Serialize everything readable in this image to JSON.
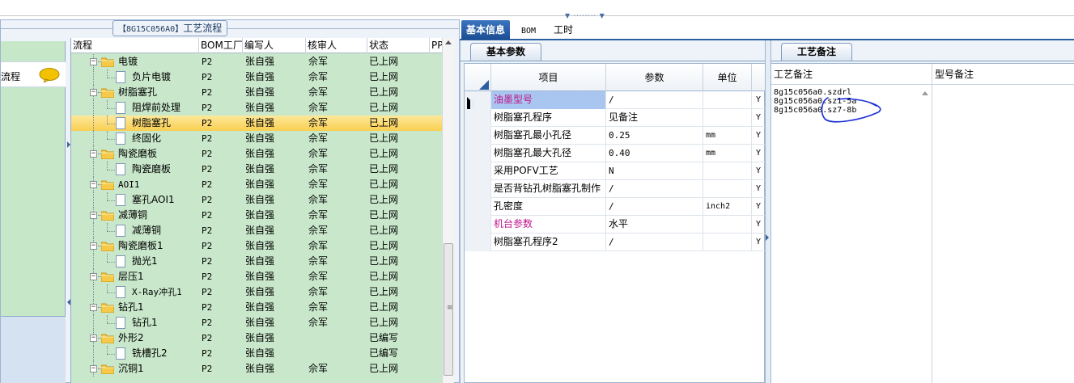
{
  "left_panel": {
    "title_code": "【8G15C056A0】",
    "title_text": "工艺流程",
    "nav_item_label": "流程",
    "tree_columns": [
      "流程",
      "BOM工厂",
      "编写人",
      "核审人",
      "状态",
      "PP"
    ],
    "tree_rows": [
      {
        "name": "电镀",
        "type": "folder",
        "bom": "P2",
        "writer": "张自强",
        "reviewer": "佘军",
        "status": "已上网"
      },
      {
        "name": "负片电镀",
        "type": "doc",
        "bom": "P2",
        "writer": "张自强",
        "reviewer": "佘军",
        "status": "已上网"
      },
      {
        "name": "树脂塞孔",
        "type": "folder",
        "bom": "P2",
        "writer": "张自强",
        "reviewer": "佘军",
        "status": "已上网"
      },
      {
        "name": "阻焊前处理",
        "type": "doc",
        "bom": "P2",
        "writer": "张自强",
        "reviewer": "佘军",
        "status": "已上网"
      },
      {
        "name": "树脂塞孔",
        "type": "doc",
        "bom": "P2",
        "writer": "张自强",
        "reviewer": "佘军",
        "status": "已上网",
        "selected": true
      },
      {
        "name": "终固化",
        "type": "doc",
        "bom": "P2",
        "writer": "张自强",
        "reviewer": "佘军",
        "status": "已上网"
      },
      {
        "name": "陶瓷磨板",
        "type": "folder",
        "bom": "P2",
        "writer": "张自强",
        "reviewer": "佘军",
        "status": "已上网"
      },
      {
        "name": "陶瓷磨板",
        "type": "doc",
        "bom": "P2",
        "writer": "张自强",
        "reviewer": "佘军",
        "status": "已上网"
      },
      {
        "name": "AOI1",
        "type": "folder",
        "bom": "P2",
        "writer": "张自强",
        "reviewer": "佘军",
        "status": "已上网"
      },
      {
        "name": "塞孔AOI1",
        "type": "doc",
        "bom": "P2",
        "writer": "张自强",
        "reviewer": "佘军",
        "status": "已上网"
      },
      {
        "name": "减薄铜",
        "type": "folder",
        "bom": "P2",
        "writer": "张自强",
        "reviewer": "佘军",
        "status": "已上网"
      },
      {
        "name": "减薄铜",
        "type": "doc",
        "bom": "P2",
        "writer": "张自强",
        "reviewer": "佘军",
        "status": "已上网"
      },
      {
        "name": "陶瓷磨板1",
        "type": "folder",
        "bom": "P2",
        "writer": "张自强",
        "reviewer": "佘军",
        "status": "已上网"
      },
      {
        "name": "抛光1",
        "type": "doc",
        "bom": "P2",
        "writer": "张自强",
        "reviewer": "佘军",
        "status": "已上网"
      },
      {
        "name": "层压1",
        "type": "folder",
        "bom": "P2",
        "writer": "张自强",
        "reviewer": "佘军",
        "status": "已上网"
      },
      {
        "name": "X-Ray冲孔1",
        "type": "doc",
        "bom": "P2",
        "writer": "张自强",
        "reviewer": "佘军",
        "status": "已上网"
      },
      {
        "name": "钻孔1",
        "type": "folder",
        "bom": "P2",
        "writer": "张自强",
        "reviewer": "佘军",
        "status": "已上网"
      },
      {
        "name": "钻孔1",
        "type": "doc",
        "bom": "P2",
        "writer": "张自强",
        "reviewer": "佘军",
        "status": "已上网"
      },
      {
        "name": "外形2",
        "type": "folder",
        "bom": "P2",
        "writer": "张自强",
        "reviewer": "",
        "status": "已编写"
      },
      {
        "name": "铣槽孔2",
        "type": "doc",
        "bom": "P2",
        "writer": "张自强",
        "reviewer": "",
        "status": "已编写"
      },
      {
        "name": "沉铜1",
        "type": "folder",
        "bom": "P2",
        "writer": "张自强",
        "reviewer": "佘军",
        "status": "已上网"
      }
    ]
  },
  "main_tabs": [
    "基本信息",
    "BOM",
    "工时"
  ],
  "basic_params": {
    "tab_label": "基本参数",
    "columns": [
      "项目",
      "参数",
      "单位"
    ],
    "rows": [
      {
        "item": "油墨型号",
        "param": "/",
        "unit": "",
        "flag": "Y",
        "highlight": true,
        "current": true
      },
      {
        "item": "树脂塞孔程序",
        "param": "见备注",
        "unit": "",
        "flag": "Y"
      },
      {
        "item": "树脂塞孔最小孔径",
        "param": "0.25",
        "unit": "mm",
        "flag": "Y"
      },
      {
        "item": "树脂塞孔最大孔径",
        "param": "0.40",
        "unit": "mm",
        "flag": "Y"
      },
      {
        "item": "采用POFV工艺",
        "param": "N",
        "unit": "",
        "flag": "Y"
      },
      {
        "item": "是否背钻孔树脂塞孔制作",
        "param": "/",
        "unit": "",
        "flag": "Y"
      },
      {
        "item": "孔密度",
        "param": "/",
        "unit": "inch2",
        "flag": "Y"
      },
      {
        "item": "机台参数",
        "param": "水平",
        "unit": "",
        "flag": "Y",
        "highlight": true
      },
      {
        "item": "树脂塞孔程序2",
        "param": "/",
        "unit": "",
        "flag": "Y"
      }
    ]
  },
  "process_notes": {
    "tab_label": "工艺备注",
    "columns": [
      "工艺备注",
      "型号备注"
    ],
    "notes_text": "8g15c056a0.szdrl\n8g15c056a0.sz1-5a\n8g15c056a0.sz7-8b"
  },
  "colors": {
    "accent": "#2b5f9e",
    "tree_bg": "#c9e8cb",
    "selected_row": "#f9cf52",
    "highlight_text": "#c0138c",
    "annotation": "#1d2fd6"
  }
}
